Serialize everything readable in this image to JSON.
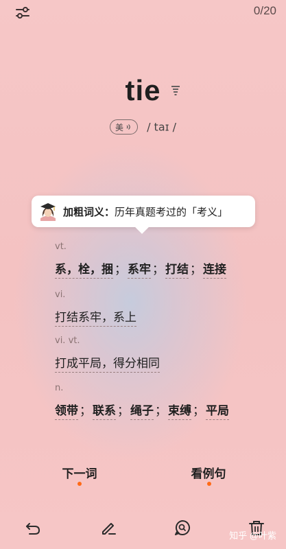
{
  "header": {
    "counter": "0/20",
    "settings_icon": "sliders-icon"
  },
  "word": {
    "text": "tie",
    "list_icon": "list-icon"
  },
  "pronunciation": {
    "accent": "美",
    "ipa": "/ taɪ /",
    "icon": "speaker-icon"
  },
  "tooltip": {
    "title": "加粗词义：",
    "text": "历年真题考过的「考义」",
    "avatar": "teacher-avatar-icon"
  },
  "definitions": [
    {
      "pos": "vt.",
      "meanings": [
        "系，栓，捆",
        "系牢",
        "打结",
        "连接"
      ]
    },
    {
      "pos": "vi.",
      "meanings": [
        "打结系牢，系上"
      ]
    },
    {
      "pos": "vi. vt.",
      "meanings": [
        "打成平局，得分相同"
      ]
    },
    {
      "pos": "n.",
      "meanings": [
        "领带",
        "联系",
        "绳子",
        "束缚",
        "平局"
      ]
    }
  ],
  "separator": "；",
  "actions": {
    "next": "下一词",
    "examples": "看例句"
  },
  "toolbar": [
    "undo-icon",
    "edit-icon",
    "search-bubble-icon",
    "delete-icon"
  ],
  "watermark": "知乎 @叶紫",
  "colors": {
    "background": "#f5c4c4",
    "accent_dot": "#ff6a16"
  }
}
